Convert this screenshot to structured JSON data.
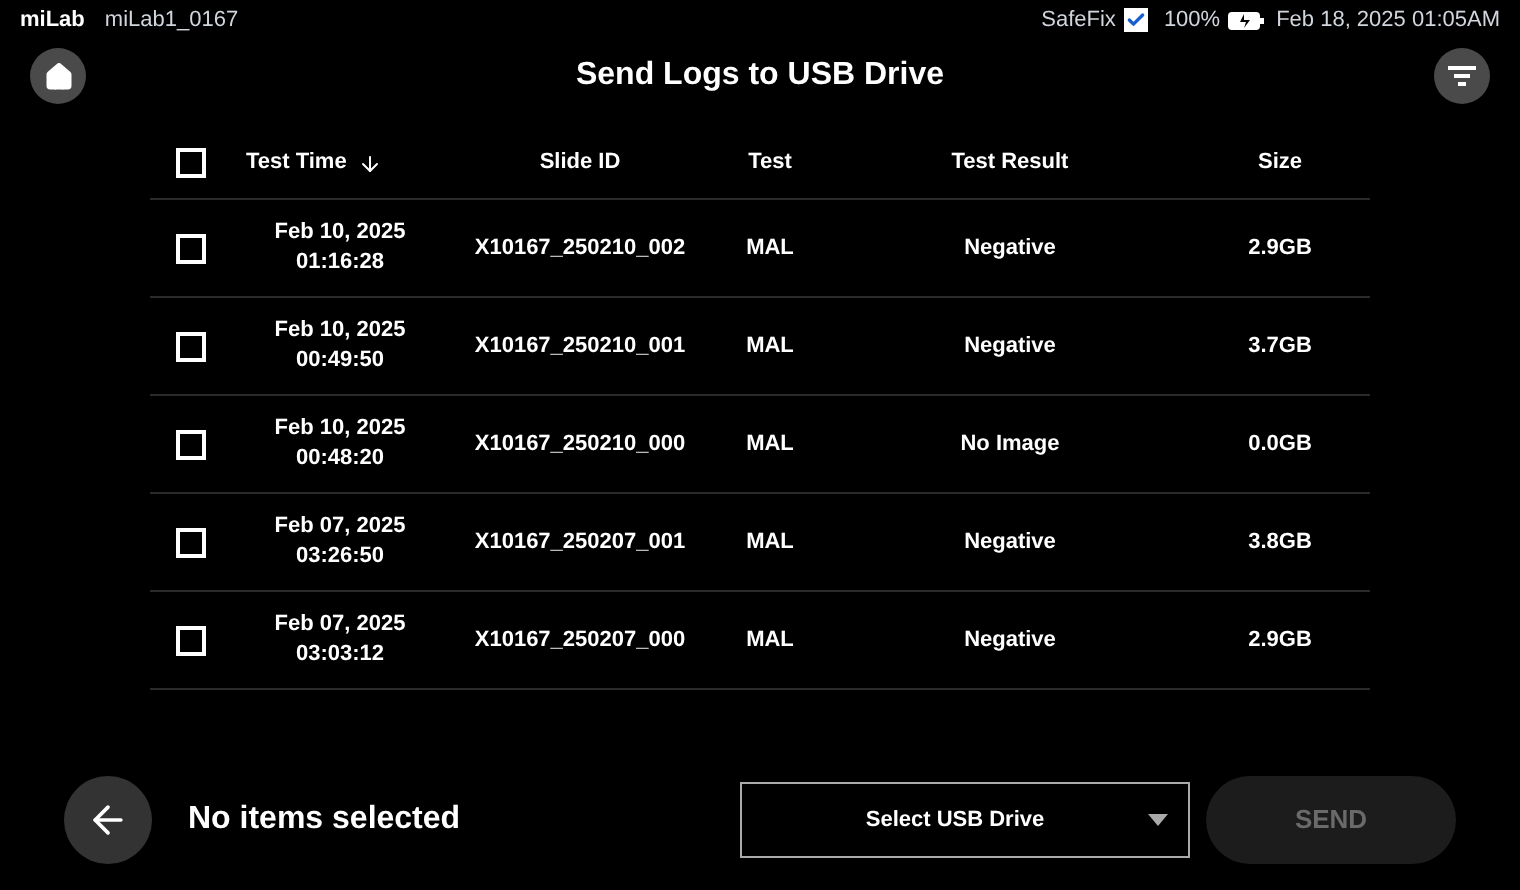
{
  "status_bar": {
    "brand": "miLab",
    "device": "miLab1_0167",
    "safefix_label": "SafeFix",
    "safefix_checked": true,
    "battery": "100%",
    "datetime": "Feb 18, 2025 01:05AM"
  },
  "title": "Send Logs to USB Drive",
  "table": {
    "select_all_checked": false,
    "columns": [
      {
        "label": "Test Time",
        "sorted": true
      },
      {
        "label": "Slide ID"
      },
      {
        "label": "Test"
      },
      {
        "label": "Test Result"
      },
      {
        "label": "Size"
      }
    ],
    "rows": [
      {
        "checked": false,
        "date": "Feb 10, 2025",
        "time": "01:16:28",
        "slide_id": "X10167_250210_002",
        "test": "MAL",
        "result": "Negative",
        "size": "2.9GB"
      },
      {
        "checked": false,
        "date": "Feb 10, 2025",
        "time": "00:49:50",
        "slide_id": "X10167_250210_001",
        "test": "MAL",
        "result": "Negative",
        "size": "3.7GB"
      },
      {
        "checked": false,
        "date": "Feb 10, 2025",
        "time": "00:48:20",
        "slide_id": "X10167_250210_000",
        "test": "MAL",
        "result": "No Image",
        "size": "0.0GB"
      },
      {
        "checked": false,
        "date": "Feb 07, 2025",
        "time": "03:26:50",
        "slide_id": "X10167_250207_001",
        "test": "MAL",
        "result": "Negative",
        "size": "3.8GB"
      },
      {
        "checked": false,
        "date": "Feb 07, 2025",
        "time": "03:03:12",
        "slide_id": "X10167_250207_000",
        "test": "MAL",
        "result": "Negative",
        "size": "2.9GB"
      }
    ]
  },
  "footer": {
    "selection_text": "No items selected",
    "drive_select": {
      "placeholder": "Select USB Drive"
    },
    "send_button": {
      "label": "SEND",
      "disabled": true
    }
  }
}
